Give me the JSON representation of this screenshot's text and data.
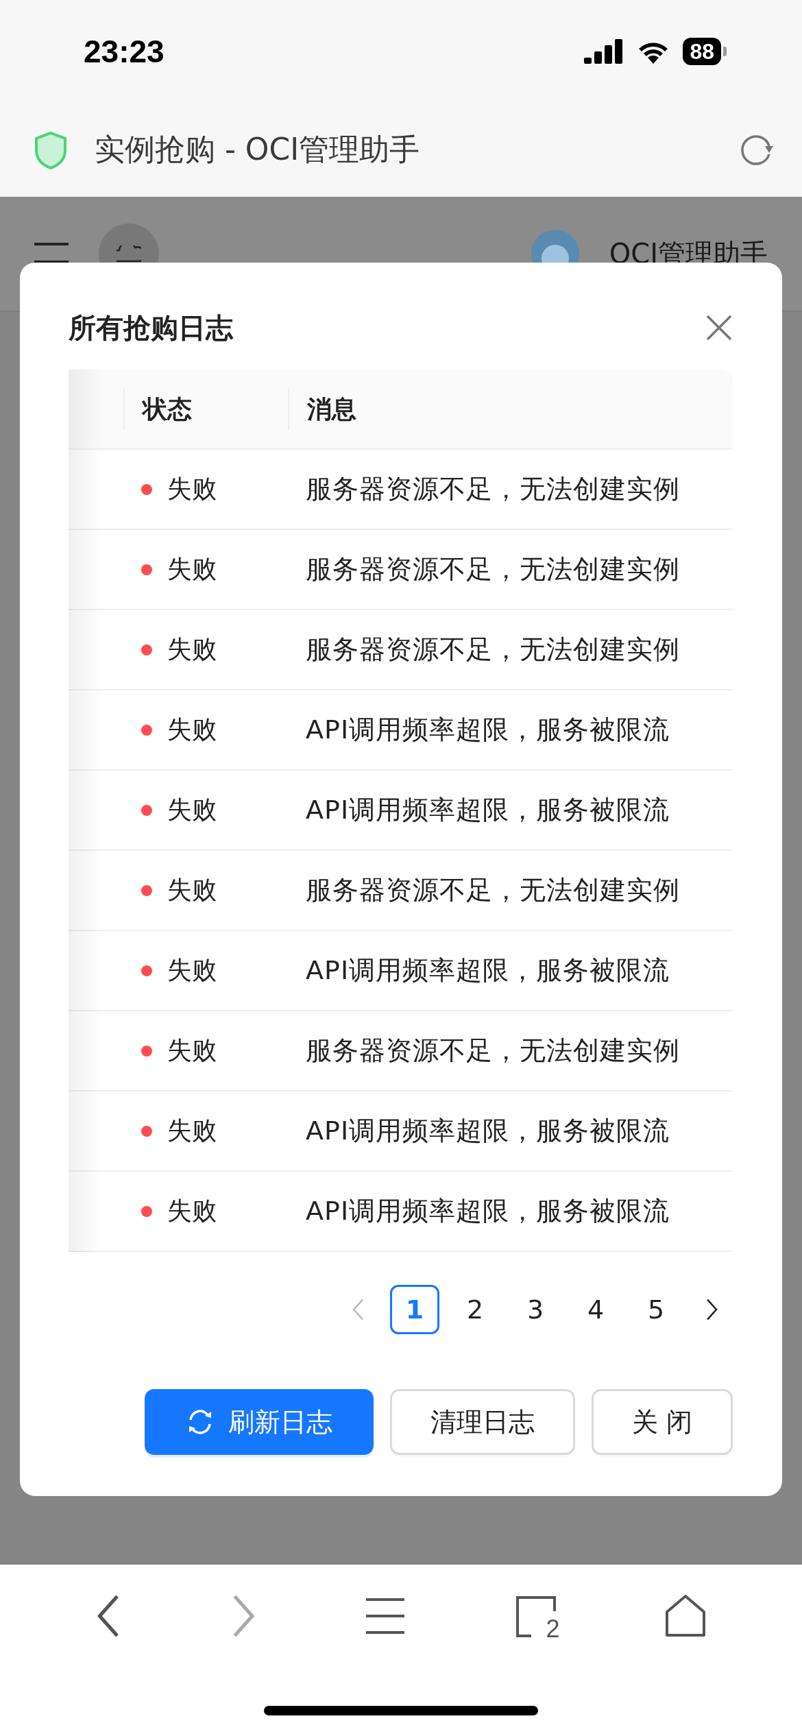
{
  "status_bar": {
    "time": "23:23",
    "battery": "88"
  },
  "browser": {
    "page_title": "实例抢购 - OCI管理助手",
    "tab_count": "2"
  },
  "page_header": {
    "title": "OCI管理助手"
  },
  "dialog": {
    "title": "所有抢购日志",
    "columns": [
      {
        "label": "状态"
      },
      {
        "label": "消息"
      }
    ],
    "rows": [
      {
        "status": "失败",
        "color": "#ff4d4f",
        "message": "服务器资源不足，无法创建实例"
      },
      {
        "status": "失败",
        "color": "#ff4d4f",
        "message": "服务器资源不足，无法创建实例"
      },
      {
        "status": "失败",
        "color": "#ff4d4f",
        "message": "服务器资源不足，无法创建实例"
      },
      {
        "status": "失败",
        "color": "#ff4d4f",
        "message": "API调用频率超限，服务被限流"
      },
      {
        "status": "失败",
        "color": "#ff4d4f",
        "message": "API调用频率超限，服务被限流"
      },
      {
        "status": "失败",
        "color": "#ff4d4f",
        "message": "服务器资源不足，无法创建实例"
      },
      {
        "status": "失败",
        "color": "#ff4d4f",
        "message": "API调用频率超限，服务被限流"
      },
      {
        "status": "失败",
        "color": "#ff4d4f",
        "message": "服务器资源不足，无法创建实例"
      },
      {
        "status": "失败",
        "color": "#ff4d4f",
        "message": "API调用频率超限，服务被限流"
      },
      {
        "status": "失败",
        "color": "#ff4d4f",
        "message": "API调用频率超限，服务被限流"
      }
    ],
    "pagination": {
      "prev_disabled": true,
      "next_disabled": false,
      "pages": [
        {
          "label": "1",
          "selected": true
        },
        {
          "label": "2",
          "selected": false
        },
        {
          "label": "3",
          "selected": false
        },
        {
          "label": "4",
          "selected": false
        },
        {
          "label": "5",
          "selected": false
        }
      ]
    },
    "buttons": [
      {
        "label": "刷新日志",
        "kind": "primary"
      },
      {
        "label": "清理日志",
        "kind": "default"
      },
      {
        "label": "关 闭",
        "kind": "default"
      }
    ]
  }
}
